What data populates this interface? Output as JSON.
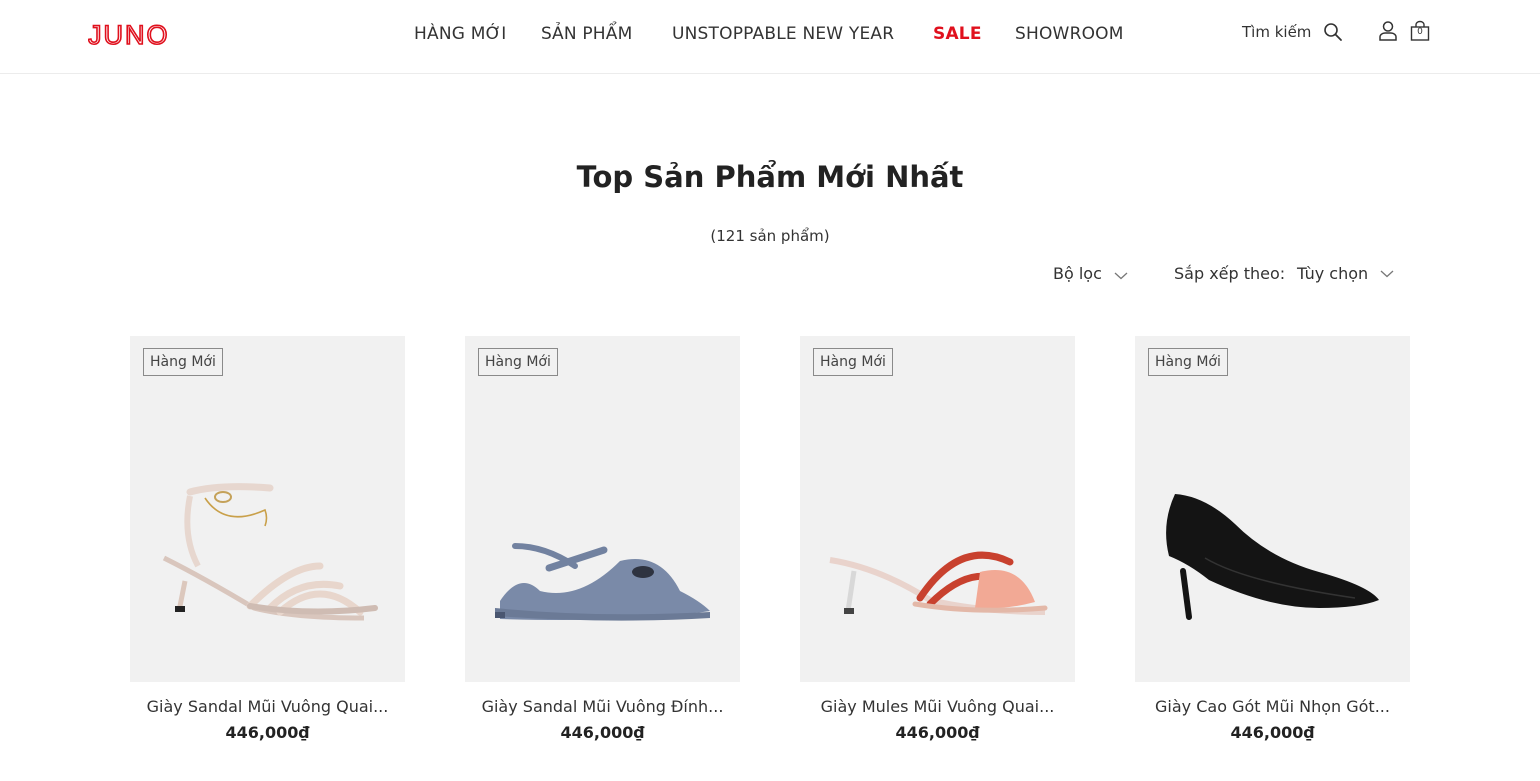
{
  "header": {
    "logo_text": "JUNO",
    "brand_color": "#e0101d",
    "nav": [
      "HÀNG MỚI",
      "SẢN PHẨM",
      "UNSTOPPABLE NEW YEAR",
      "SALE",
      "SHOWROOM"
    ],
    "search_label": "Tìm kiếm",
    "cart_count": "0",
    "icons": [
      "search-icon",
      "user-icon",
      "shopping-bag-icon"
    ]
  },
  "main": {
    "title": "Top Sản Phẩm Mới Nhất",
    "count": "(121 sản phẩm)",
    "filter_label": "Bộ lọc",
    "sort_label": "Sắp xếp theo:",
    "sort_value": "Tùy chọn"
  },
  "products": [
    {
      "badge": "Hàng Mới",
      "name": "Giày Sandal Mũi Vuông Quai...",
      "price": "446,000₫"
    },
    {
      "badge": "Hàng Mới",
      "name": "Giày Sandal Mũi Vuông Đính...",
      "price": "446,000₫"
    },
    {
      "badge": "Hàng Mới",
      "name": "Giày Mules Mũi Vuông Quai...",
      "price": "446,000₫"
    },
    {
      "badge": "Hàng Mới",
      "name": "Giày Cao Gót Mũi Nhọn Gót...",
      "price": "446,000₫"
    }
  ]
}
